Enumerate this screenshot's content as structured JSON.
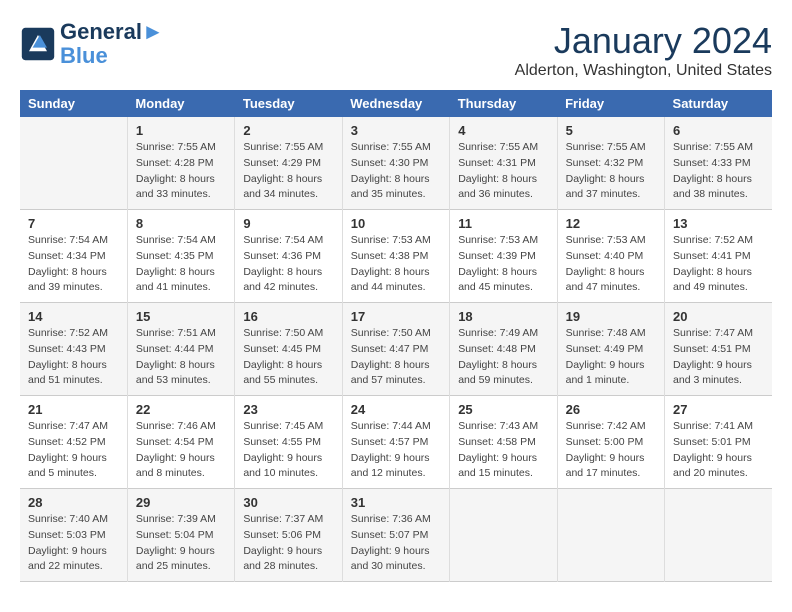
{
  "logo": {
    "line1": "General",
    "line2": "Blue"
  },
  "title": "January 2024",
  "subtitle": "Alderton, Washington, United States",
  "weekdays": [
    "Sunday",
    "Monday",
    "Tuesday",
    "Wednesday",
    "Thursday",
    "Friday",
    "Saturday"
  ],
  "weeks": [
    [
      {
        "day": "",
        "sunrise": "",
        "sunset": "",
        "daylight": ""
      },
      {
        "day": "1",
        "sunrise": "Sunrise: 7:55 AM",
        "sunset": "Sunset: 4:28 PM",
        "daylight": "Daylight: 8 hours and 33 minutes."
      },
      {
        "day": "2",
        "sunrise": "Sunrise: 7:55 AM",
        "sunset": "Sunset: 4:29 PM",
        "daylight": "Daylight: 8 hours and 34 minutes."
      },
      {
        "day": "3",
        "sunrise": "Sunrise: 7:55 AM",
        "sunset": "Sunset: 4:30 PM",
        "daylight": "Daylight: 8 hours and 35 minutes."
      },
      {
        "day": "4",
        "sunrise": "Sunrise: 7:55 AM",
        "sunset": "Sunset: 4:31 PM",
        "daylight": "Daylight: 8 hours and 36 minutes."
      },
      {
        "day": "5",
        "sunrise": "Sunrise: 7:55 AM",
        "sunset": "Sunset: 4:32 PM",
        "daylight": "Daylight: 8 hours and 37 minutes."
      },
      {
        "day": "6",
        "sunrise": "Sunrise: 7:55 AM",
        "sunset": "Sunset: 4:33 PM",
        "daylight": "Daylight: 8 hours and 38 minutes."
      }
    ],
    [
      {
        "day": "7",
        "sunrise": "Sunrise: 7:54 AM",
        "sunset": "Sunset: 4:34 PM",
        "daylight": "Daylight: 8 hours and 39 minutes."
      },
      {
        "day": "8",
        "sunrise": "Sunrise: 7:54 AM",
        "sunset": "Sunset: 4:35 PM",
        "daylight": "Daylight: 8 hours and 41 minutes."
      },
      {
        "day": "9",
        "sunrise": "Sunrise: 7:54 AM",
        "sunset": "Sunset: 4:36 PM",
        "daylight": "Daylight: 8 hours and 42 minutes."
      },
      {
        "day": "10",
        "sunrise": "Sunrise: 7:53 AM",
        "sunset": "Sunset: 4:38 PM",
        "daylight": "Daylight: 8 hours and 44 minutes."
      },
      {
        "day": "11",
        "sunrise": "Sunrise: 7:53 AM",
        "sunset": "Sunset: 4:39 PM",
        "daylight": "Daylight: 8 hours and 45 minutes."
      },
      {
        "day": "12",
        "sunrise": "Sunrise: 7:53 AM",
        "sunset": "Sunset: 4:40 PM",
        "daylight": "Daylight: 8 hours and 47 minutes."
      },
      {
        "day": "13",
        "sunrise": "Sunrise: 7:52 AM",
        "sunset": "Sunset: 4:41 PM",
        "daylight": "Daylight: 8 hours and 49 minutes."
      }
    ],
    [
      {
        "day": "14",
        "sunrise": "Sunrise: 7:52 AM",
        "sunset": "Sunset: 4:43 PM",
        "daylight": "Daylight: 8 hours and 51 minutes."
      },
      {
        "day": "15",
        "sunrise": "Sunrise: 7:51 AM",
        "sunset": "Sunset: 4:44 PM",
        "daylight": "Daylight: 8 hours and 53 minutes."
      },
      {
        "day": "16",
        "sunrise": "Sunrise: 7:50 AM",
        "sunset": "Sunset: 4:45 PM",
        "daylight": "Daylight: 8 hours and 55 minutes."
      },
      {
        "day": "17",
        "sunrise": "Sunrise: 7:50 AM",
        "sunset": "Sunset: 4:47 PM",
        "daylight": "Daylight: 8 hours and 57 minutes."
      },
      {
        "day": "18",
        "sunrise": "Sunrise: 7:49 AM",
        "sunset": "Sunset: 4:48 PM",
        "daylight": "Daylight: 8 hours and 59 minutes."
      },
      {
        "day": "19",
        "sunrise": "Sunrise: 7:48 AM",
        "sunset": "Sunset: 4:49 PM",
        "daylight": "Daylight: 9 hours and 1 minute."
      },
      {
        "day": "20",
        "sunrise": "Sunrise: 7:47 AM",
        "sunset": "Sunset: 4:51 PM",
        "daylight": "Daylight: 9 hours and 3 minutes."
      }
    ],
    [
      {
        "day": "21",
        "sunrise": "Sunrise: 7:47 AM",
        "sunset": "Sunset: 4:52 PM",
        "daylight": "Daylight: 9 hours and 5 minutes."
      },
      {
        "day": "22",
        "sunrise": "Sunrise: 7:46 AM",
        "sunset": "Sunset: 4:54 PM",
        "daylight": "Daylight: 9 hours and 8 minutes."
      },
      {
        "day": "23",
        "sunrise": "Sunrise: 7:45 AM",
        "sunset": "Sunset: 4:55 PM",
        "daylight": "Daylight: 9 hours and 10 minutes."
      },
      {
        "day": "24",
        "sunrise": "Sunrise: 7:44 AM",
        "sunset": "Sunset: 4:57 PM",
        "daylight": "Daylight: 9 hours and 12 minutes."
      },
      {
        "day": "25",
        "sunrise": "Sunrise: 7:43 AM",
        "sunset": "Sunset: 4:58 PM",
        "daylight": "Daylight: 9 hours and 15 minutes."
      },
      {
        "day": "26",
        "sunrise": "Sunrise: 7:42 AM",
        "sunset": "Sunset: 5:00 PM",
        "daylight": "Daylight: 9 hours and 17 minutes."
      },
      {
        "day": "27",
        "sunrise": "Sunrise: 7:41 AM",
        "sunset": "Sunset: 5:01 PM",
        "daylight": "Daylight: 9 hours and 20 minutes."
      }
    ],
    [
      {
        "day": "28",
        "sunrise": "Sunrise: 7:40 AM",
        "sunset": "Sunset: 5:03 PM",
        "daylight": "Daylight: 9 hours and 22 minutes."
      },
      {
        "day": "29",
        "sunrise": "Sunrise: 7:39 AM",
        "sunset": "Sunset: 5:04 PM",
        "daylight": "Daylight: 9 hours and 25 minutes."
      },
      {
        "day": "30",
        "sunrise": "Sunrise: 7:37 AM",
        "sunset": "Sunset: 5:06 PM",
        "daylight": "Daylight: 9 hours and 28 minutes."
      },
      {
        "day": "31",
        "sunrise": "Sunrise: 7:36 AM",
        "sunset": "Sunset: 5:07 PM",
        "daylight": "Daylight: 9 hours and 30 minutes."
      },
      {
        "day": "",
        "sunrise": "",
        "sunset": "",
        "daylight": ""
      },
      {
        "day": "",
        "sunrise": "",
        "sunset": "",
        "daylight": ""
      },
      {
        "day": "",
        "sunrise": "",
        "sunset": "",
        "daylight": ""
      }
    ]
  ]
}
